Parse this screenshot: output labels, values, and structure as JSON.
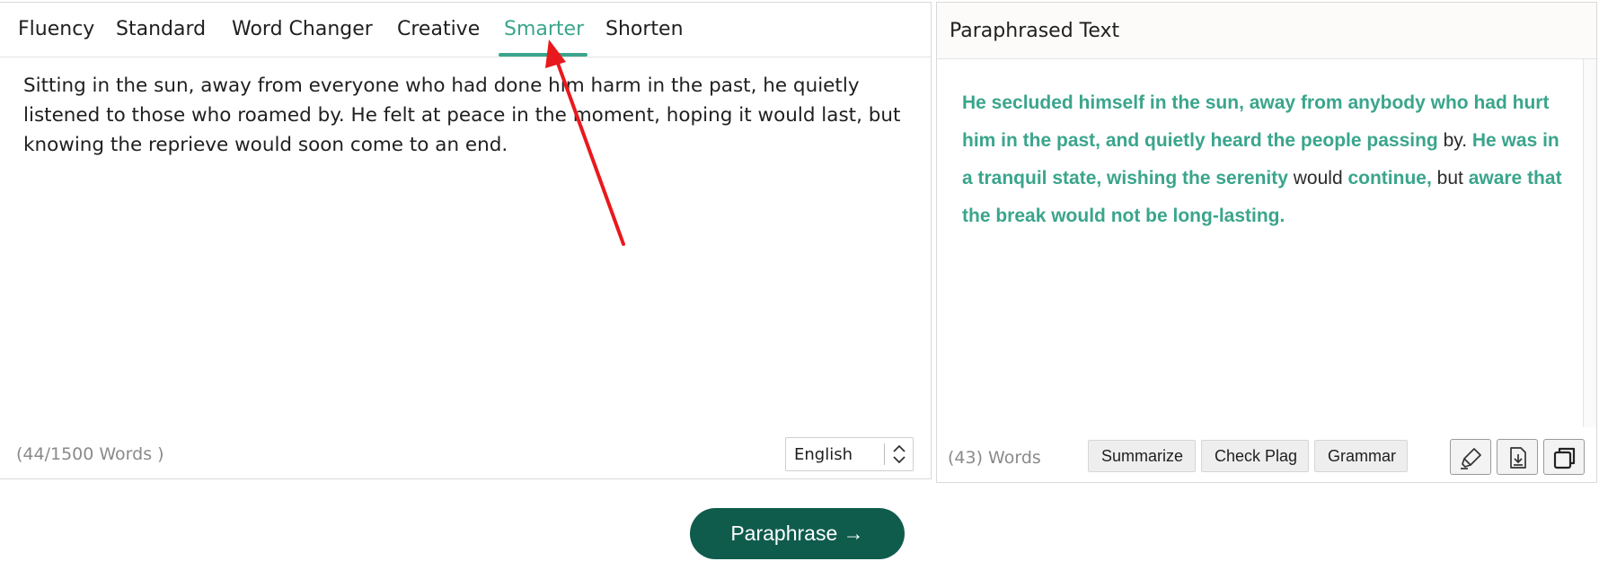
{
  "tabs": [
    {
      "label": "Fluency"
    },
    {
      "label": "Standard"
    },
    {
      "label": "Word Changer"
    },
    {
      "label": "Creative"
    },
    {
      "label": "Smarter"
    },
    {
      "label": "Shorten"
    }
  ],
  "active_tab": "Smarter",
  "input": {
    "text": "Sitting in the sun, away from everyone who had done him harm in the past, he quietly listened to those who roamed by. He felt at peace in the moment, hoping it would last, but knowing the reprieve would soon come to an end.",
    "word_count": "(44/1500 Words )",
    "language": "English"
  },
  "output": {
    "title": "Paraphrased Text",
    "segments": [
      {
        "text": "He secluded himself in the sun, away from anybody who had hurt him in the past, and quietly heard the people passing",
        "changed": true
      },
      {
        "text": " by. ",
        "changed": false
      },
      {
        "text": "He was in a tranquil state, wishing the serenity",
        "changed": true
      },
      {
        "text": " would ",
        "changed": false
      },
      {
        "text": "continue,",
        "changed": true
      },
      {
        "text": " but ",
        "changed": false
      },
      {
        "text": "aware that the break would not be long-lasting.",
        "changed": true
      }
    ],
    "word_count": "(43) Words"
  },
  "actions": {
    "summarize": "Summarize",
    "check_plag": "Check Plag",
    "grammar": "Grammar"
  },
  "icons": [
    "highlighter-icon",
    "download-icon",
    "copy-icon"
  ],
  "paraphrase_button": "Paraphrase →",
  "colors": {
    "accent": "#3aa58c",
    "button_dark": "#0f5c4d",
    "annotation_arrow": "#e8191d"
  }
}
